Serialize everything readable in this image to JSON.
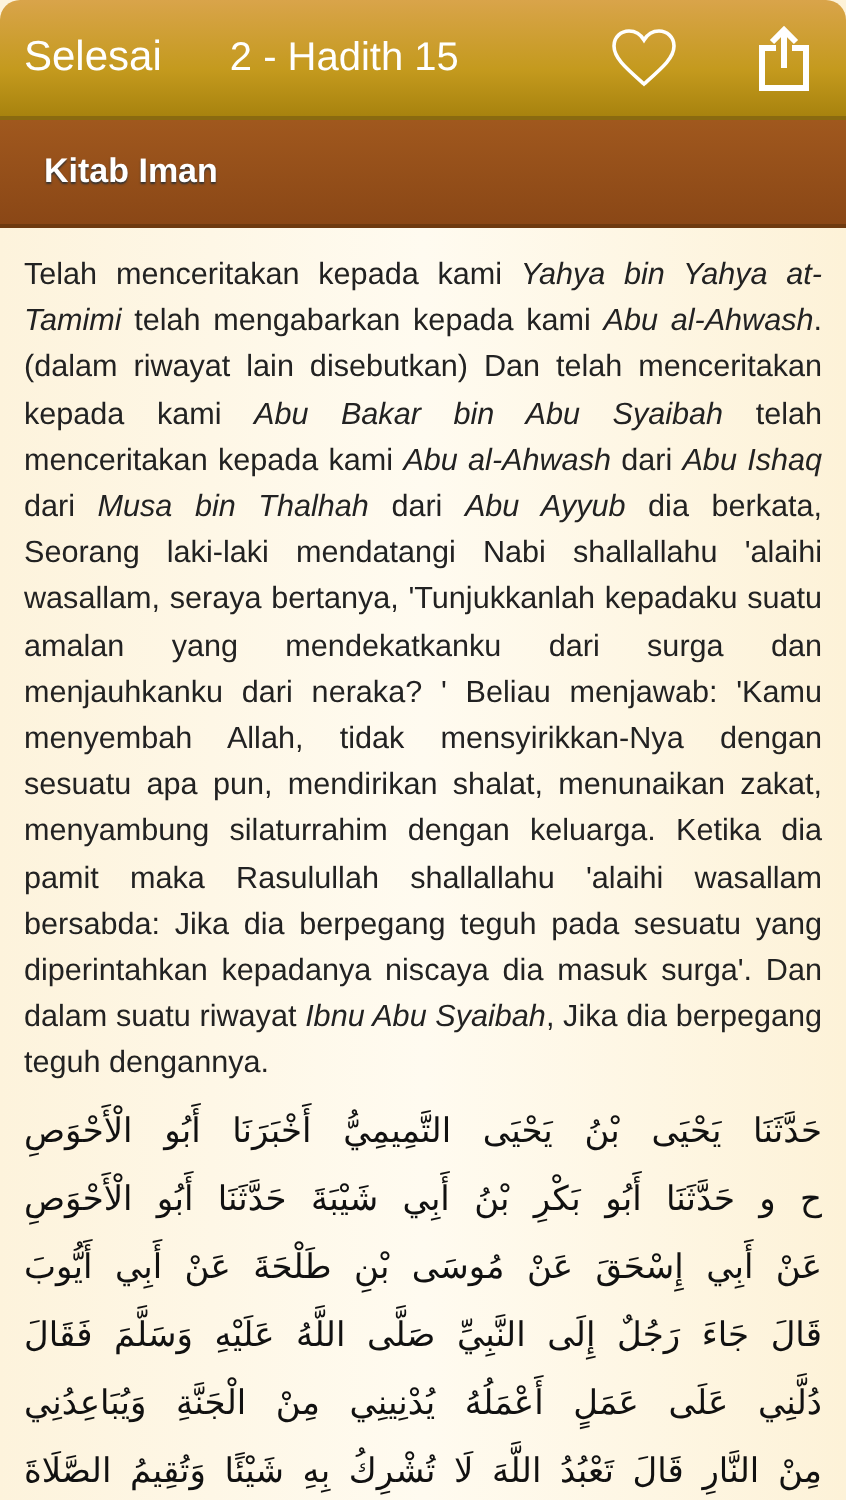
{
  "nav_bar": {
    "back_button": "Selesai",
    "title": "2 - Hadith 15"
  },
  "section_header": {
    "title": "Kitab Iman"
  },
  "translation": "Telah menceritakan kepada kami *Yahya bin Yahya at-Tamimi* telah mengabarkan kepada kami *Abu al-Ahwash*. (dalam riwayat lain disebutkan) Dan telah menceritakan kepada kami *Abu Bakar bin Abu Syaibah* telah menceritakan kepada kami *Abu al-Ahwash* dari *Abu Ishaq* dari *Musa bin Thalhah* dari *Abu Ayyub* dia berkata, Seorang laki-laki mendatangi Nabi shallallahu 'alaihi wasallam, seraya bertanya, 'Tunjukkanlah kepadaku suatu amalan yang mendekatkanku dari surga dan menjauhkanku dari neraka? ' Beliau menjawab: 'Kamu menyembah Allah, tidak mensyirikkan-Nya dengan sesuatu apa pun, mendirikan shalat, menunaikan zakat, menyambung silaturrahim dengan keluarga. Ketika dia pamit maka Rasulullah shallallahu 'alaihi wasallam bersabda: Jika dia berpegang teguh pada sesuatu yang diperintahkan kepadanya niscaya dia masuk surga'. Dan dalam suatu riwayat *Ibnu Abu Syaibah*, Jika dia berpegang teguh dengannya.",
  "arabic_lines": [
    "حَدَّثَنَا يَحْيَى بْنُ يَحْيَى التَّمِيمِيُّ أَخْبَرَنَا أَبُو الْأَحْوَصِ",
    "ح و حَدَّثَنَا أَبُو بَكْرِ بْنُ أَبِي شَيْبَةَ حَدَّثَنَا أَبُو الْأَحْوَصِ",
    "عَنْ أَبِي إِسْحَقَ عَنْ مُوسَى بْنِ طَلْحَةَ عَنْ أَبِي أَيُّوبَ",
    "قَالَ جَاءَ رَجُلٌ إِلَى النَّبِيِّ صَلَّى اللَّهُ عَلَيْهِ وَسَلَّمَ فَقَالَ",
    "دُلَّنِي عَلَى عَمَلٍ أَعْمَلُهُ يُدْنِينِي مِنْ الْجَنَّةِ وَيُبَاعِدُنِي",
    "مِنْ النَّارِ قَالَ تَعْبُدُ اللَّهَ لَا تُشْرِكُ بِهِ شَيْئًا وَتُقِيمُ الصَّلَاةَ"
  ]
}
